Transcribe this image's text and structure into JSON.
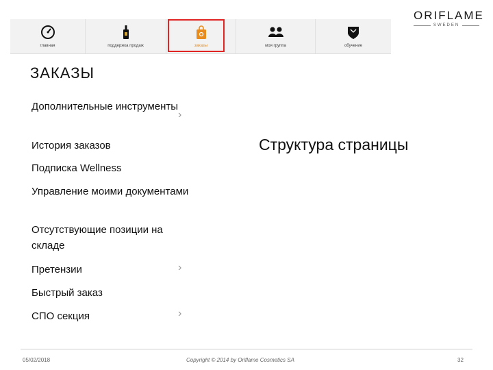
{
  "brand": {
    "logo_text": "ORIFLAME",
    "logo_sub": "SWEDEN"
  },
  "nav": [
    {
      "label": "главная",
      "icon": "gauge-icon"
    },
    {
      "label": "поддержка продаж",
      "icon": "bottle-icon"
    },
    {
      "label": "заказы",
      "icon": "shopping-bag-icon",
      "active": true
    },
    {
      "label": "моя группа",
      "icon": "group-icon"
    },
    {
      "label": "обучение",
      "icon": "academy-shield-icon"
    }
  ],
  "section": {
    "title": "ЗАКАЗЫ"
  },
  "menu_items": [
    {
      "label": "Дополнительные инструменты",
      "has_chevron": true
    },
    {
      "label": "История заказов",
      "has_chevron": false
    },
    {
      "label": "Подписка Wellness",
      "has_chevron": false
    },
    {
      "label": "Управление моими документами",
      "has_chevron": false
    },
    {
      "label": "Отсутствующие позиции на складе",
      "has_chevron": false
    },
    {
      "label": "Претензии",
      "has_chevron": true
    },
    {
      "label": "Быстрый заказ",
      "has_chevron": false
    },
    {
      "label": "СПО секция",
      "has_chevron": true
    }
  ],
  "chevron_glyph": "›",
  "caption": "Структура страницы",
  "footer": {
    "date": "05/02/2018",
    "copyright": "Copyright © 2014 by Oriflame Cosmetics SA",
    "page": "32"
  },
  "colors": {
    "accent": "#e88c1e",
    "active_frame": "#e02424",
    "nav_bg": "#f2f2f2"
  }
}
